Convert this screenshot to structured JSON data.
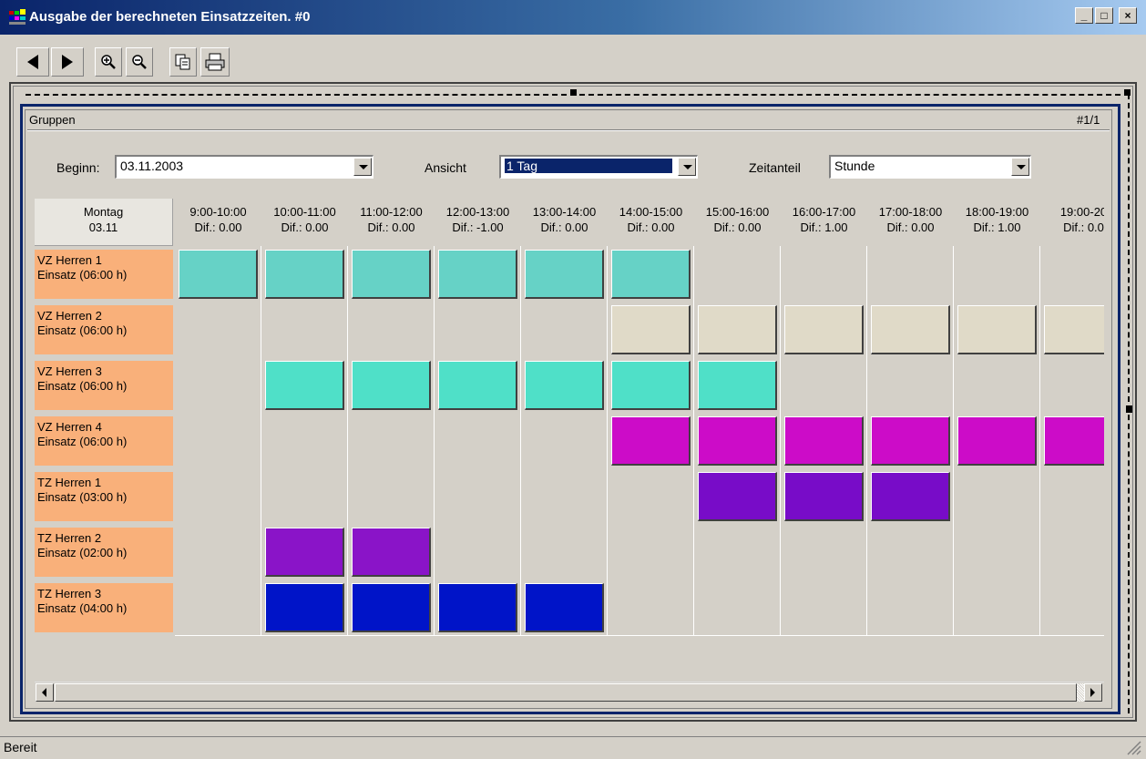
{
  "window": {
    "title": "Ausgabe der berechneten Einsatzzeiten. #0",
    "buttons": [
      "_",
      "□",
      "×"
    ]
  },
  "toolbar": {
    "icons": [
      "back-arrow-icon",
      "forward-arrow-icon",
      "zoom-in-icon",
      "zoom-out-icon",
      "copy-icon",
      "print-icon"
    ]
  },
  "panel": {
    "title": "Gruppen",
    "page": "#1/1"
  },
  "controls": {
    "beginn_label": "Beginn:",
    "beginn_value": "03.11.2003",
    "ansicht_label": "Ansicht",
    "ansicht_value": "1 Tag",
    "zeitanteil_label": "Zeitanteil",
    "zeitanteil_value": "Stunde"
  },
  "schedule": {
    "day_name": "Montag",
    "day_date": "03.11",
    "columns": [
      {
        "time": "9:00-10:00",
        "dif": "Dif.: 0.00"
      },
      {
        "time": "10:00-11:00",
        "dif": "Dif.: 0.00"
      },
      {
        "time": "11:00-12:00",
        "dif": "Dif.: 0.00"
      },
      {
        "time": "12:00-13:00",
        "dif": "Dif.: -1.00"
      },
      {
        "time": "13:00-14:00",
        "dif": "Dif.: 0.00"
      },
      {
        "time": "14:00-15:00",
        "dif": "Dif.: 0.00"
      },
      {
        "time": "15:00-16:00",
        "dif": "Dif.: 0.00"
      },
      {
        "time": "16:00-17:00",
        "dif": "Dif.: 1.00"
      },
      {
        "time": "17:00-18:00",
        "dif": "Dif.: 0.00"
      },
      {
        "time": "18:00-19:00",
        "dif": "Dif.: 1.00"
      },
      {
        "time": "19:00-20",
        "dif": "Dif.: 0.0"
      }
    ],
    "rows": [
      {
        "name": "VZ Herren 1",
        "einsatz": "Einsatz (06:00 h)",
        "color": "#66d2c6",
        "start": 0,
        "end": 5
      },
      {
        "name": "VZ Herren 2",
        "einsatz": "Einsatz (06:00 h)",
        "color": "#e0dac8",
        "start": 5,
        "end": 10
      },
      {
        "name": "VZ Herren 3",
        "einsatz": "Einsatz (06:00 h)",
        "color": "#4fe0c8",
        "start": 1,
        "end": 6
      },
      {
        "name": "VZ Herren 4",
        "einsatz": "Einsatz (06:00 h)",
        "color": "#cc0cc8",
        "start": 5,
        "end": 10
      },
      {
        "name": "TZ Herren 1",
        "einsatz": "Einsatz (03:00 h)",
        "color": "#780cc8",
        "start": 6,
        "end": 8
      },
      {
        "name": "TZ Herren 2",
        "einsatz": "Einsatz (02:00 h)",
        "color": "#8a14c8",
        "start": 1,
        "end": 2
      },
      {
        "name": "TZ Herren 3",
        "einsatz": "Einsatz (04:00 h)",
        "color": "#0014c8",
        "start": 1,
        "end": 4
      }
    ]
  },
  "statusbar": {
    "text": "Bereit"
  }
}
